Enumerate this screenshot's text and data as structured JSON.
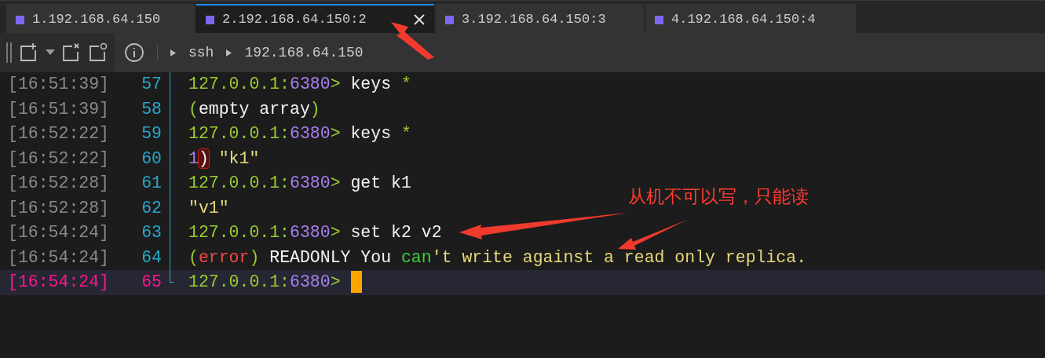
{
  "tabs": [
    {
      "label": "1.192.168.64.150",
      "selected": false
    },
    {
      "label": "2.192.168.64.150:2",
      "selected": true
    },
    {
      "label": "3.192.168.64.150:3",
      "selected": false
    },
    {
      "label": "4.192.168.64.150:4",
      "selected": false
    }
  ],
  "breadcrumb": [
    "ssh",
    "192.168.64.150"
  ],
  "lines": [
    {
      "time": "[16:51:39]",
      "number": "57",
      "current": false,
      "segments": [
        {
          "kind": "host",
          "text": "127.0.0.1:"
        },
        {
          "kind": "port",
          "text": "6380"
        },
        {
          "kind": "host",
          "text": ">"
        },
        {
          "kind": "plain",
          "text": " keys "
        },
        {
          "kind": "host",
          "text": "*"
        }
      ]
    },
    {
      "time": "[16:51:39]",
      "number": "58",
      "current": false,
      "segments": [
        {
          "kind": "host",
          "text": "("
        },
        {
          "kind": "plain",
          "text": "empty array"
        },
        {
          "kind": "host",
          "text": ")"
        }
      ]
    },
    {
      "time": "[16:52:22]",
      "number": "59",
      "current": false,
      "segments": [
        {
          "kind": "host",
          "text": "127.0.0.1:"
        },
        {
          "kind": "port",
          "text": "6380"
        },
        {
          "kind": "host",
          "text": ">"
        },
        {
          "kind": "plain",
          "text": " keys "
        },
        {
          "kind": "host",
          "text": "*"
        }
      ]
    },
    {
      "time": "[16:52:22]",
      "number": "60",
      "current": false,
      "segments": [
        {
          "kind": "port",
          "text": "1"
        },
        {
          "kind": "match",
          "text": ")"
        },
        {
          "kind": "string",
          "text": " \"k1\""
        }
      ]
    },
    {
      "time": "[16:52:28]",
      "number": "61",
      "current": false,
      "segments": [
        {
          "kind": "host",
          "text": "127.0.0.1:"
        },
        {
          "kind": "port",
          "text": "6380"
        },
        {
          "kind": "host",
          "text": ">"
        },
        {
          "kind": "plain",
          "text": " get k1"
        }
      ]
    },
    {
      "time": "[16:52:28]",
      "number": "62",
      "current": false,
      "segments": [
        {
          "kind": "string",
          "text": "\"v1\""
        }
      ]
    },
    {
      "time": "[16:54:24]",
      "number": "63",
      "current": false,
      "segments": [
        {
          "kind": "host",
          "text": "127.0.0.1:"
        },
        {
          "kind": "port",
          "text": "6380"
        },
        {
          "kind": "host",
          "text": ">"
        },
        {
          "kind": "plain",
          "text": " set k2 v2"
        }
      ]
    },
    {
      "time": "[16:54:24]",
      "number": "64",
      "current": false,
      "segments": [
        {
          "kind": "host",
          "text": "("
        },
        {
          "kind": "error",
          "text": "error"
        },
        {
          "kind": "host",
          "text": ")"
        },
        {
          "kind": "plain",
          "text": " READONLY You "
        },
        {
          "kind": "green",
          "text": "can"
        },
        {
          "kind": "string",
          "text": "'t write against a read only replica."
        }
      ]
    },
    {
      "time": "[16:54:24]",
      "number": "65",
      "current": true,
      "segments": [
        {
          "kind": "host",
          "text": "127.0.0.1:"
        },
        {
          "kind": "port",
          "text": "6380"
        },
        {
          "kind": "host",
          "text": ">"
        }
      ]
    }
  ],
  "annotation": "从机不可以写，只能读"
}
